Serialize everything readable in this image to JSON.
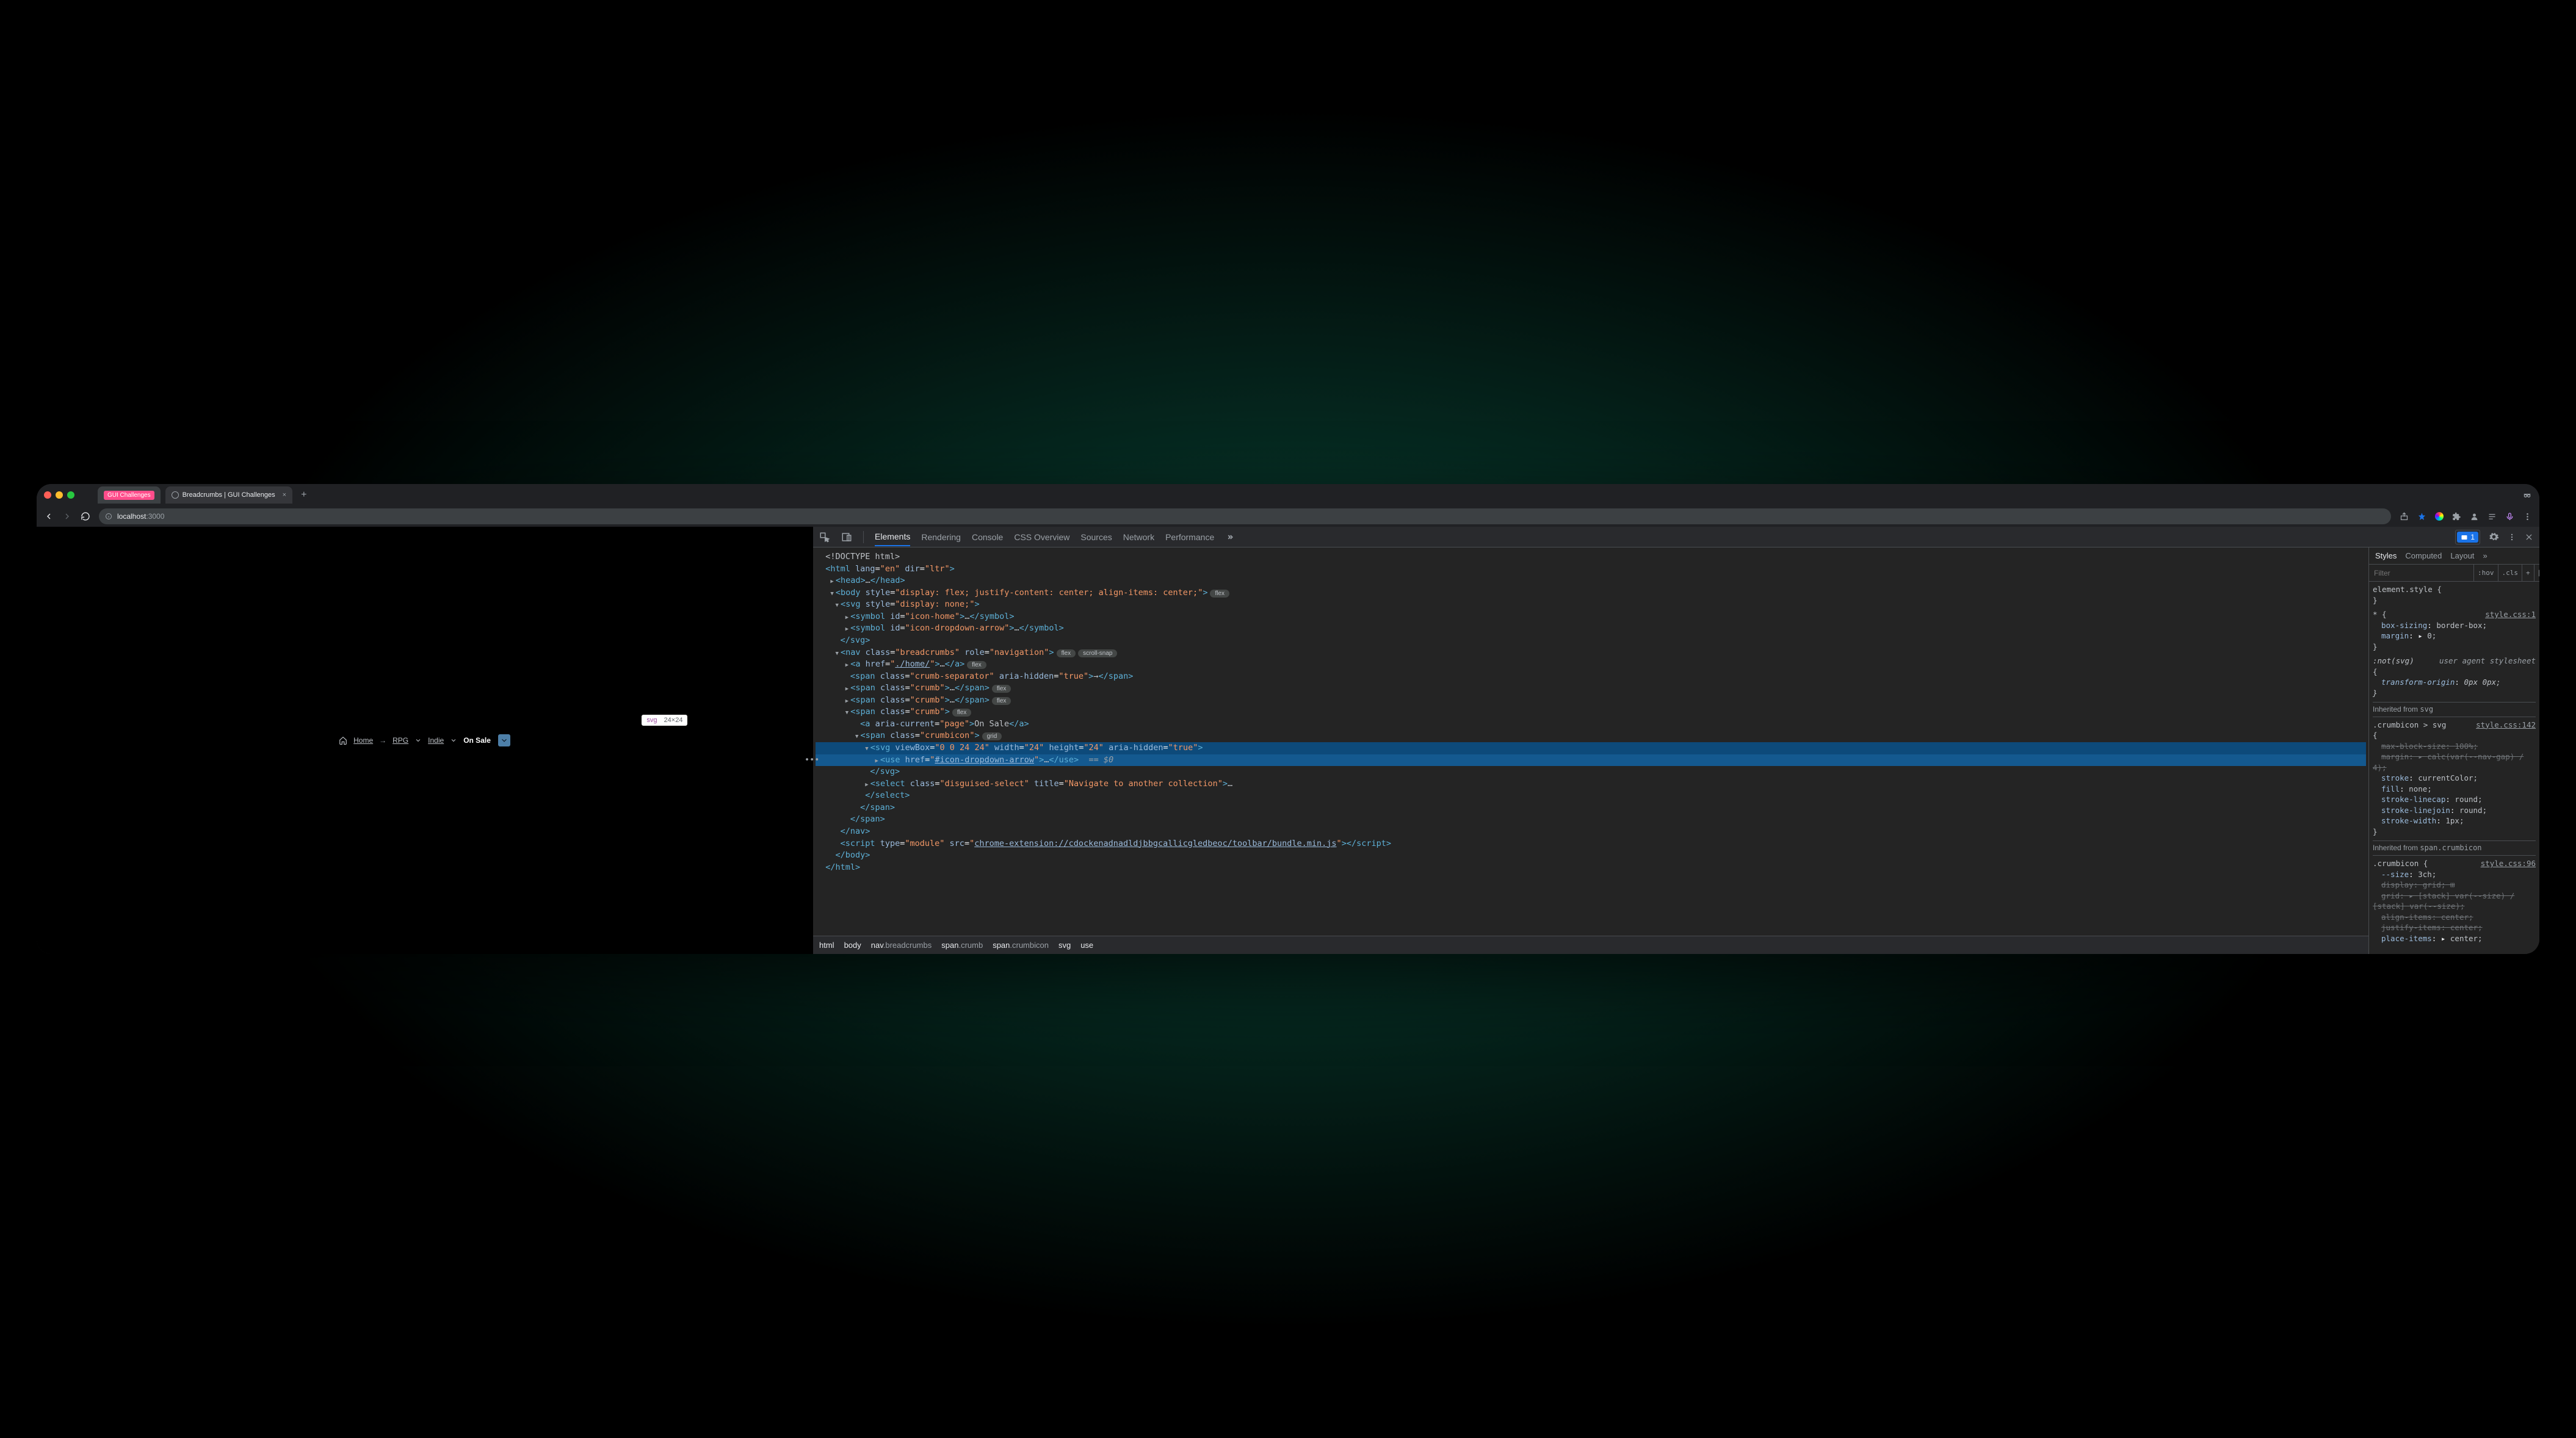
{
  "titlebar": {
    "tab_inactive": "GUI Challenges",
    "tab_active": "Breadcrumbs | GUI Challenges"
  },
  "urlbar": {
    "host": "localhost",
    "path": ":3000"
  },
  "page": {
    "crumbs": {
      "home": "Home",
      "rpg": "RPG",
      "indie": "Indie",
      "onsale": "On Sale"
    },
    "tooltip_tag": "svg",
    "tooltip_dim": "24×24"
  },
  "devtools": {
    "tabs": {
      "elements": "Elements",
      "rendering": "Rendering",
      "console": "Console",
      "overview": "CSS Overview",
      "sources": "Sources",
      "network": "Network",
      "performance": "Performance"
    },
    "issue_count": "1",
    "tree": {
      "doctype": "<!DOCTYPE html>",
      "html_attrs": {
        "lang": "en",
        "dir": "ltr"
      },
      "body_style": "display: flex; justify-content: center; align-items: center;",
      "svg_style": "display: none;",
      "sym1": "icon-home",
      "sym2": "icon-dropdown-arrow",
      "nav_class": "breadcrumbs",
      "nav_role": "navigation",
      "a_href": "./home/",
      "sep_class": "crumb-separator",
      "sep_aria": "true",
      "crumb_class": "crumb",
      "page_a": "On Sale",
      "crumbicon_class": "crumbicon",
      "svg_viewbox": "0 0 24 24",
      "svg_w": "24",
      "svg_h": "24",
      "svg_aria": "true",
      "use_href": "#icon-dropdown-arrow",
      "select_class": "disguised-select",
      "select_title": "Navigate to another collection",
      "script_type": "module",
      "script_src": "chrome-extension://cdockenadnadldjbbgcallicgledbeoc/toolbar/bundle.min.js"
    },
    "trail": {
      "html": "html",
      "body": "body",
      "nav": "nav",
      "navcls": ".breadcrumbs",
      "span": "span",
      "crumb": ".crumb",
      "span2": "span",
      "crumbicon": ".crumbicon",
      "svg": "svg",
      "use": "use"
    },
    "styles": {
      "tabs": {
        "styles": "Styles",
        "computed": "Computed",
        "layout": "Layout"
      },
      "filter": "Filter",
      "hov": ":hov",
      "cls": ".cls",
      "elstyle": "element.style {",
      "star_src": "style.css:1",
      "box": "box-sizing",
      "box_v": "border-box;",
      "margin0": "margin",
      "margin0_v": "0;",
      "notsvg": ":not(svg)",
      "ua_label": "user agent stylesheet",
      "to": "transform-origin",
      "to_v": "0px 0px;",
      "inh_svg": "Inherited from",
      "inh_svg_tag": "svg",
      "rule2_sel": ".crumbicon > svg",
      "rule2_src": "style.css:142",
      "mbs": "max-block-size",
      "mbs_v": "100%;",
      "mg": "margin",
      "mg_v": "calc(var(--nav-gap) / 4);",
      "stroke": "stroke",
      "stroke_v": "currentColor;",
      "fill": "fill",
      "fill_v": "none;",
      "slc": "stroke-linecap",
      "slc_v": "round;",
      "slj": "stroke-linejoin",
      "slj_v": "round;",
      "sw": "stroke-width",
      "sw_v": "1px;",
      "inh_ci": "Inherited from",
      "inh_ci_tag": "span.crumbicon",
      "rule3_sel": ".crumbicon {",
      "rule3_src": "style.css:96",
      "size": "--size",
      "size_v": "3ch;",
      "disp": "display",
      "disp_v": "grid;",
      "grid": "grid",
      "grid_v": "[stack] var(--size) / [stack] var(--size);",
      "ai": "align-items",
      "ai_v": "center;",
      "ji": "justify-items",
      "ji_v": "center;",
      "pi": "place-items",
      "pi_v": "center;"
    }
  }
}
